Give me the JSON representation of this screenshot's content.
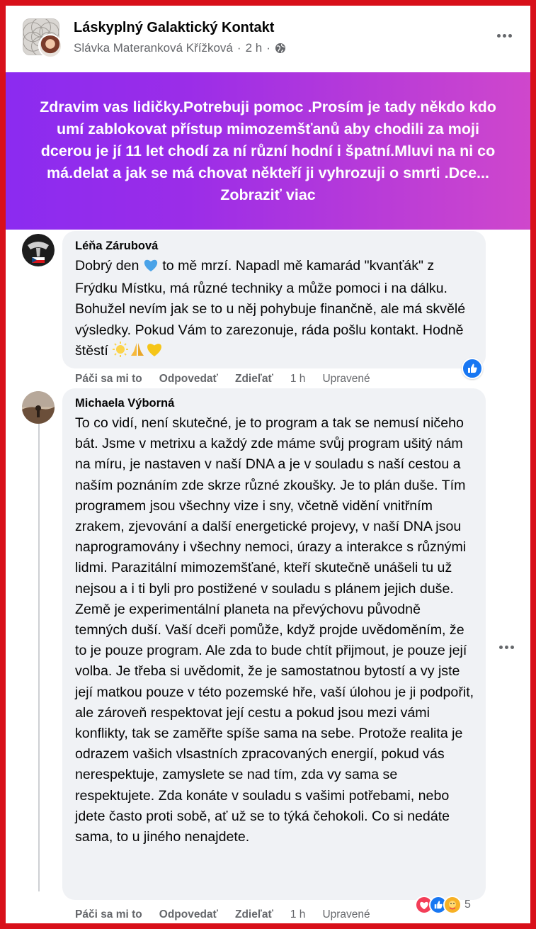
{
  "post": {
    "group_name": "Láskyplný Galaktický Kontakt",
    "author": "Slávka Materanková Křížková",
    "time": "2 h",
    "separator": "·",
    "text": "Zdravim vas lidičky.Potrebuji pomoc .Prosím je tady někdo kdo umí zablokovat přístup mimozemšťanů aby chodili za moji dcerou je jí 11 let chodí za ní různí hodní i špatní.Mluvi na ni co má.delat a jak se má chovat někteří ji vyhrozuji o smrti .Dce...",
    "see_more": "Zobraziť viac",
    "banner_colors": [
      "#8b2bf0",
      "#cf47cc"
    ]
  },
  "comments": [
    {
      "author": "Léňa Zárubová",
      "text_part1": "Dobrý den",
      "text_part2": "to mě mrzí. Napadl mě kamarád \"kvanťák\" z Frýdku Místku, má různé techniky a může pomoci i na dálku. Bohužel nevím jak se to u něj pohybuje finančně, ale má skvělé výsledky. Pokud Vám to zarezonuje, ráda pošlu kontakt. Hodně štěstí",
      "emoji_inline": "blue-heart",
      "emoji_end": [
        "sun",
        "folded-hands",
        "yellow-heart"
      ],
      "actions": {
        "like": "Páči sa mi to",
        "reply": "Odpovedať",
        "share": "Zdieľať",
        "time": "1 h",
        "edited": "Upravené"
      },
      "reactions": [
        "like"
      ]
    },
    {
      "author": "Michaela Výborná",
      "text": "To co vidí, není skutečné, je to program a tak se nemusí ničeho bát. Jsme v metrixu a každý zde máme svůj program ušitý nám na míru, je nastaven v naší DNA a je v souladu s naší cestou a naším poznáním zde skrze různé zkoušky. Je to plán duše. Tím programem jsou všechny vize i sny, včetně vidění vnitřním zrakem, zjevování a další energetické projevy, v naší DNA jsou naprogramovány i všechny nemoci, úrazy a interakce s různými lidmi. Parazitální mimozemšťané, kteří skutečně unášeli tu už nejsou a i ti byli pro postižené v souladu s plánem jejich duše. Země je experimentální planeta na převýchovu původně temných duší. Vaší dceři pomůže, když projde uvědoměním, že to je pouze program. Ale zda to bude chtít přijmout, je pouze její volba. Je třeba si uvědomit, že je samostatnou bytostí a vy jste její matkou pouze v této pozemské hře, vaší úlohou je ji podpořit, ale zároveň respektovat její cestu a pokud jsou mezi vámi konflikty, tak se zaměřte spíše sama na sebe. Protože realita je odrazem vašich vlsastních zpracovaných energií, pokud vás nerespektuje, zamyslete se nad tím, zda vy sama se respektujete. Zda konáte v souladu s vašimi potřebami, nebo jdete často proti sobě, ať už se to týká čehokoli. Co si nedáte sama, to u jiného nenajdete.",
      "actions": {
        "like": "Páči sa mi to",
        "reply": "Odpovedať",
        "share": "Zdieľať",
        "time": "1 h",
        "edited": "Upravené"
      },
      "reactions": [
        "love",
        "like",
        "care"
      ],
      "reaction_count": "5"
    }
  ],
  "colors": {
    "frame": "#d8101a",
    "like_blue": "#1877f2",
    "love_red": "#f33e58",
    "care_yellow": "#f7b125",
    "meta_gray": "#65676b",
    "bubble_bg": "#f0f2f5"
  }
}
